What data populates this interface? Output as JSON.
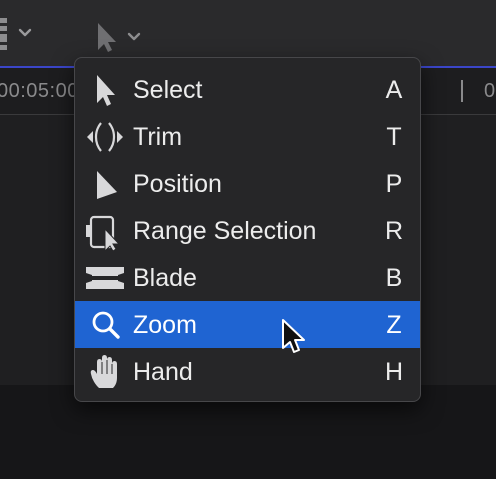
{
  "toolbar": {
    "left_control_icon": "clip-appearance-icon",
    "tools_icon": "arrow-pointer-icon",
    "dropdown_icon": "chevron-down-icon"
  },
  "ruler": {
    "left_time": "00:05:00",
    "right_time": "0"
  },
  "menu": {
    "items": [
      {
        "label": "Select",
        "shortcut": "A",
        "icon": "select-arrow-icon"
      },
      {
        "label": "Trim",
        "shortcut": "T",
        "icon": "trim-icon"
      },
      {
        "label": "Position",
        "shortcut": "P",
        "icon": "position-arrow-icon"
      },
      {
        "label": "Range Selection",
        "shortcut": "R",
        "icon": "range-selection-icon"
      },
      {
        "label": "Blade",
        "shortcut": "B",
        "icon": "blade-icon"
      },
      {
        "label": "Zoom",
        "shortcut": "Z",
        "icon": "zoom-magnifier-icon"
      },
      {
        "label": "Hand",
        "shortcut": "H",
        "icon": "hand-icon"
      }
    ],
    "selected_index": 5
  },
  "colors": {
    "accent": "#3b46c9",
    "selection": "#1f64d2",
    "menu_bg": "#262628",
    "text": "#ececec"
  }
}
